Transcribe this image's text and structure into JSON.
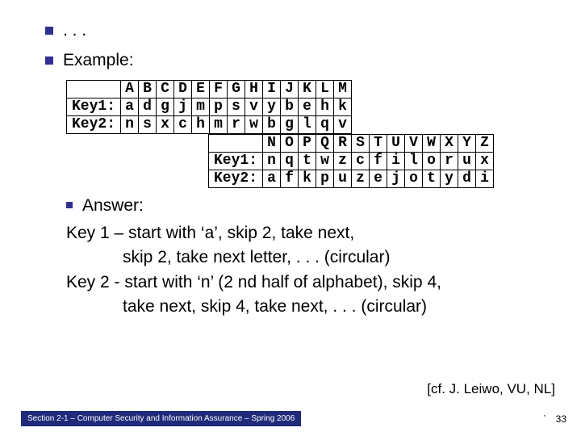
{
  "bullets": {
    "ellipsis": ". . .",
    "example": "Example:"
  },
  "table1": {
    "labels": [
      "",
      "Key1:",
      "Key2:"
    ],
    "rows": [
      [
        "A",
        "B",
        "C",
        "D",
        "E",
        "F",
        "G",
        "H",
        "I",
        "J",
        "K",
        "L",
        "M"
      ],
      [
        "a",
        "d",
        "g",
        "j",
        "m",
        "p",
        "s",
        "v",
        "y",
        "b",
        "e",
        "h",
        "k"
      ],
      [
        "n",
        "s",
        "x",
        "c",
        "h",
        "m",
        "r",
        "w",
        "b",
        "g",
        "l",
        "q",
        "v"
      ]
    ]
  },
  "table2": {
    "labels": [
      "",
      "Key1:",
      "Key2:"
    ],
    "rows": [
      [
        "N",
        "O",
        "P",
        "Q",
        "R",
        "S",
        "T",
        "U",
        "V",
        "W",
        "X",
        "Y",
        "Z"
      ],
      [
        "n",
        "q",
        "t",
        "w",
        "z",
        "c",
        "f",
        "i",
        "l",
        "o",
        "r",
        "u",
        "x"
      ],
      [
        "a",
        "f",
        "k",
        "p",
        "u",
        "z",
        "e",
        "j",
        "o",
        "t",
        "y",
        "d",
        "i"
      ]
    ]
  },
  "answer": {
    "head": "Answer:",
    "l1": "Key 1 – start with ‘a’, skip 2, take next,",
    "l2": "            skip 2, take next letter, . . . (circular)",
    "l3": "Key 2 - start with ‘n’ (2 nd half of alphabet), skip 4,",
    "l4": "            take next, skip 4, take next, . . . (circular)"
  },
  "citation": "[cf. J. Leiwo, VU, NL]",
  "footer": "Section 2-1 – Computer Security and Information Assurance – Spring 2006",
  "page_tick": "’",
  "page_num": "33"
}
